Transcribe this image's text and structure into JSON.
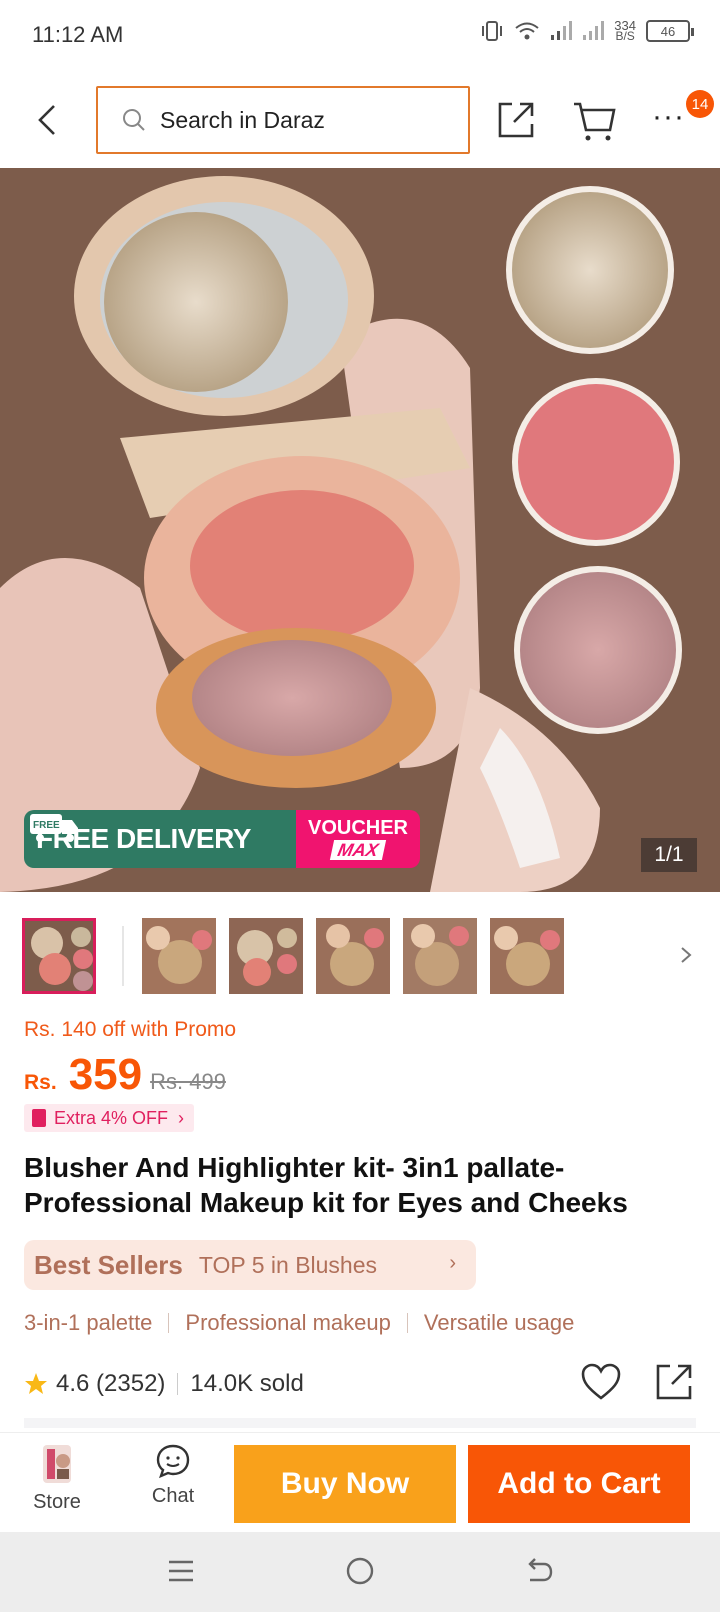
{
  "status_bar": {
    "time": "11:12 AM",
    "net_speed_value": "334",
    "net_speed_unit": "B/S",
    "battery": "46"
  },
  "header": {
    "search_placeholder": "Search in Daraz",
    "more_badge": "14"
  },
  "hero": {
    "free_delivery": "FREE DELIVERY",
    "free_tag": "FREE",
    "voucher": "VOUCHER",
    "voucher_max": "MAX",
    "page_counter": "1/1"
  },
  "pricing": {
    "promo_line": "Rs. 140 off with Promo",
    "currency": "Rs.",
    "price": "359",
    "old_price": "Rs. 499",
    "extra_off": "Extra 4% OFF"
  },
  "product": {
    "title": "Blusher And Highlighter kit- 3in1 pallate-Professional Makeup kit for Eyes and Cheeks",
    "best_sellers_label": "Best Sellers",
    "best_sellers_rank": "TOP 5 in Blushes",
    "features": [
      "3-in-1 palette",
      "Professional makeup",
      "Versatile usage"
    ],
    "rating": "4.6 (2352)",
    "sold": "14.0K sold"
  },
  "bottom_bar": {
    "store_label": "Store",
    "chat_label": "Chat",
    "buy_now": "Buy Now",
    "add_to_cart": "Add to Cart"
  },
  "colors": {
    "brand_orange": "#f85606",
    "buy_now_yellow": "#f9a11b",
    "search_border": "#e2792b",
    "free_delivery_green": "#2f7a63",
    "voucher_pink": "#f0146f",
    "best_seller_text": "#b0705a"
  },
  "icons": [
    "back-arrow-icon",
    "search-icon",
    "share-icon",
    "cart-icon",
    "more-icon",
    "star-icon",
    "heart-icon",
    "store-icon",
    "chat-icon",
    "menu-icon",
    "home-icon",
    "back-nav-icon"
  ]
}
